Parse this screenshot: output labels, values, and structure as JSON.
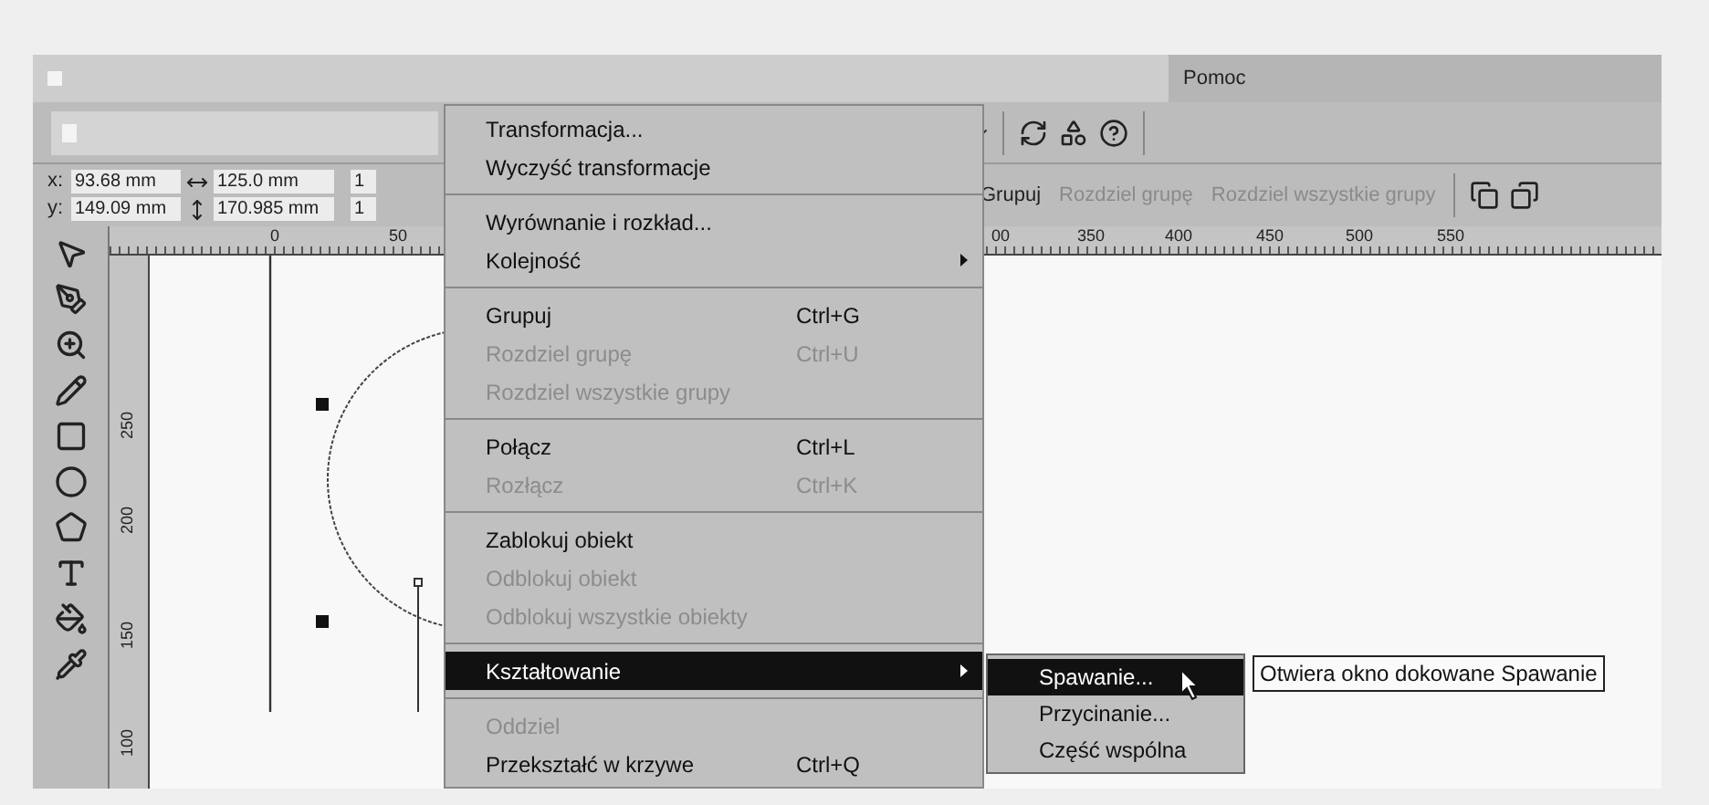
{
  "title_bar": {
    "menu": [
      {
        "label": "Pomoc"
      }
    ]
  },
  "property_bar": {
    "position": [
      {
        "axis": "x:",
        "value": "93.68 mm"
      },
      {
        "axis": "y:",
        "value": "149.09 mm"
      }
    ],
    "size": [
      {
        "value": "125.0 mm"
      },
      {
        "value": "170.985 mm"
      }
    ],
    "scale": [
      {
        "value": "1"
      },
      {
        "value": "1"
      }
    ],
    "group_buttons": [
      {
        "label": "Grupuj",
        "disabled": false
      },
      {
        "label": "Rozdziel grupę",
        "disabled": true
      },
      {
        "label": "Rozdziel wszystkie grupy",
        "disabled": true
      }
    ]
  },
  "rulers": {
    "horizontal": [
      "0",
      "50",
      "00",
      "350",
      "400",
      "450",
      "500",
      "550"
    ],
    "vertical": [
      "250",
      "200",
      "150",
      "100"
    ]
  },
  "context_menu": {
    "items": [
      {
        "kind": "item",
        "label": "Transformacja...",
        "disabled": false,
        "selected": false,
        "submenu": false
      },
      {
        "kind": "item",
        "label": "Wyczyść transformacje",
        "disabled": false,
        "selected": false,
        "submenu": false
      },
      {
        "kind": "separator"
      },
      {
        "kind": "item",
        "label": "Wyrównanie i rozkład...",
        "disabled": false,
        "selected": false,
        "submenu": false
      },
      {
        "kind": "item",
        "label": "Kolejność",
        "disabled": false,
        "selected": false,
        "submenu": true
      },
      {
        "kind": "separator"
      },
      {
        "kind": "item",
        "label": "Grupuj",
        "shortcut": "Ctrl+G",
        "disabled": false,
        "selected": false,
        "submenu": false
      },
      {
        "kind": "item",
        "label": "Rozdziel grupę",
        "shortcut": "Ctrl+U",
        "disabled": true,
        "selected": false,
        "submenu": false
      },
      {
        "kind": "item",
        "label": "Rozdziel wszystkie grupy",
        "disabled": true,
        "selected": false,
        "submenu": false
      },
      {
        "kind": "separator"
      },
      {
        "kind": "item",
        "label": "Połącz",
        "shortcut": "Ctrl+L",
        "disabled": false,
        "selected": false,
        "submenu": false
      },
      {
        "kind": "item",
        "label": "Rozłącz",
        "shortcut": "Ctrl+K",
        "disabled": true,
        "selected": false,
        "submenu": false
      },
      {
        "kind": "separator"
      },
      {
        "kind": "item",
        "label": "Zablokuj obiekt",
        "disabled": false,
        "selected": false,
        "submenu": false
      },
      {
        "kind": "item",
        "label": "Odblokuj obiekt",
        "disabled": true,
        "selected": false,
        "submenu": false
      },
      {
        "kind": "item",
        "label": "Odblokuj wszystkie obiekty",
        "disabled": true,
        "selected": false,
        "submenu": false
      },
      {
        "kind": "separator"
      },
      {
        "kind": "item",
        "label": "Kształtowanie",
        "disabled": false,
        "selected": true,
        "submenu": true
      },
      {
        "kind": "separator"
      },
      {
        "kind": "item",
        "label": "Oddziel",
        "disabled": true,
        "selected": false,
        "submenu": false
      },
      {
        "kind": "item",
        "label": "Przekształć w krzywe",
        "shortcut": "Ctrl+Q",
        "disabled": false,
        "selected": false,
        "submenu": false
      }
    ]
  },
  "submenu": {
    "items": [
      {
        "label": "Spawanie...",
        "selected": true
      },
      {
        "label": "Przycinanie...",
        "selected": false
      },
      {
        "label": "Część wspólna",
        "selected": false
      }
    ]
  },
  "tooltip": {
    "text": "Otwiera okno dokowane Spawanie"
  }
}
